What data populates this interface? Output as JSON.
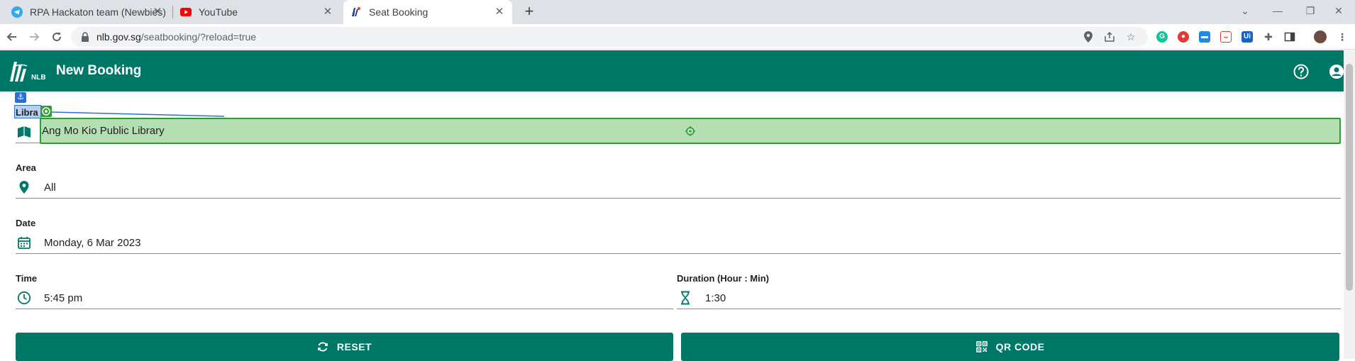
{
  "browser": {
    "tabs": [
      {
        "title": "RPA Hackaton team (Newbies)",
        "icon": "telegram-icon",
        "active": false
      },
      {
        "title": "YouTube",
        "icon": "youtube-icon",
        "active": false
      },
      {
        "title": "Seat Booking",
        "icon": "nlb-icon",
        "active": true
      }
    ],
    "url_host": "nlb.gov.sg",
    "url_path": "/seatbooking/?reload=true"
  },
  "app": {
    "logo_text": "NLB",
    "title": "New Booking",
    "brand_color": "#007868"
  },
  "form": {
    "library": {
      "label": "Libra",
      "value": "Ang Mo Kio Public Library",
      "icon": "book-icon"
    },
    "area": {
      "label": "Area",
      "value": "All",
      "icon": "location-pin-icon"
    },
    "date": {
      "label": "Date",
      "value": "Monday, 6 Mar 2023",
      "icon": "calendar-icon"
    },
    "time": {
      "label": "Time",
      "value": "5:45 pm",
      "icon": "clock-icon"
    },
    "duration": {
      "label": "Duration (Hour : Min)",
      "value": "1:30",
      "icon": "hourglass-icon"
    }
  },
  "actions": {
    "reset_label": "RESET",
    "qr_label": "QR CODE"
  },
  "overlay": {
    "anchor_color": "#2d6fd1",
    "target_color": "#2e9b35",
    "target_fill": "#b3dfb3"
  }
}
